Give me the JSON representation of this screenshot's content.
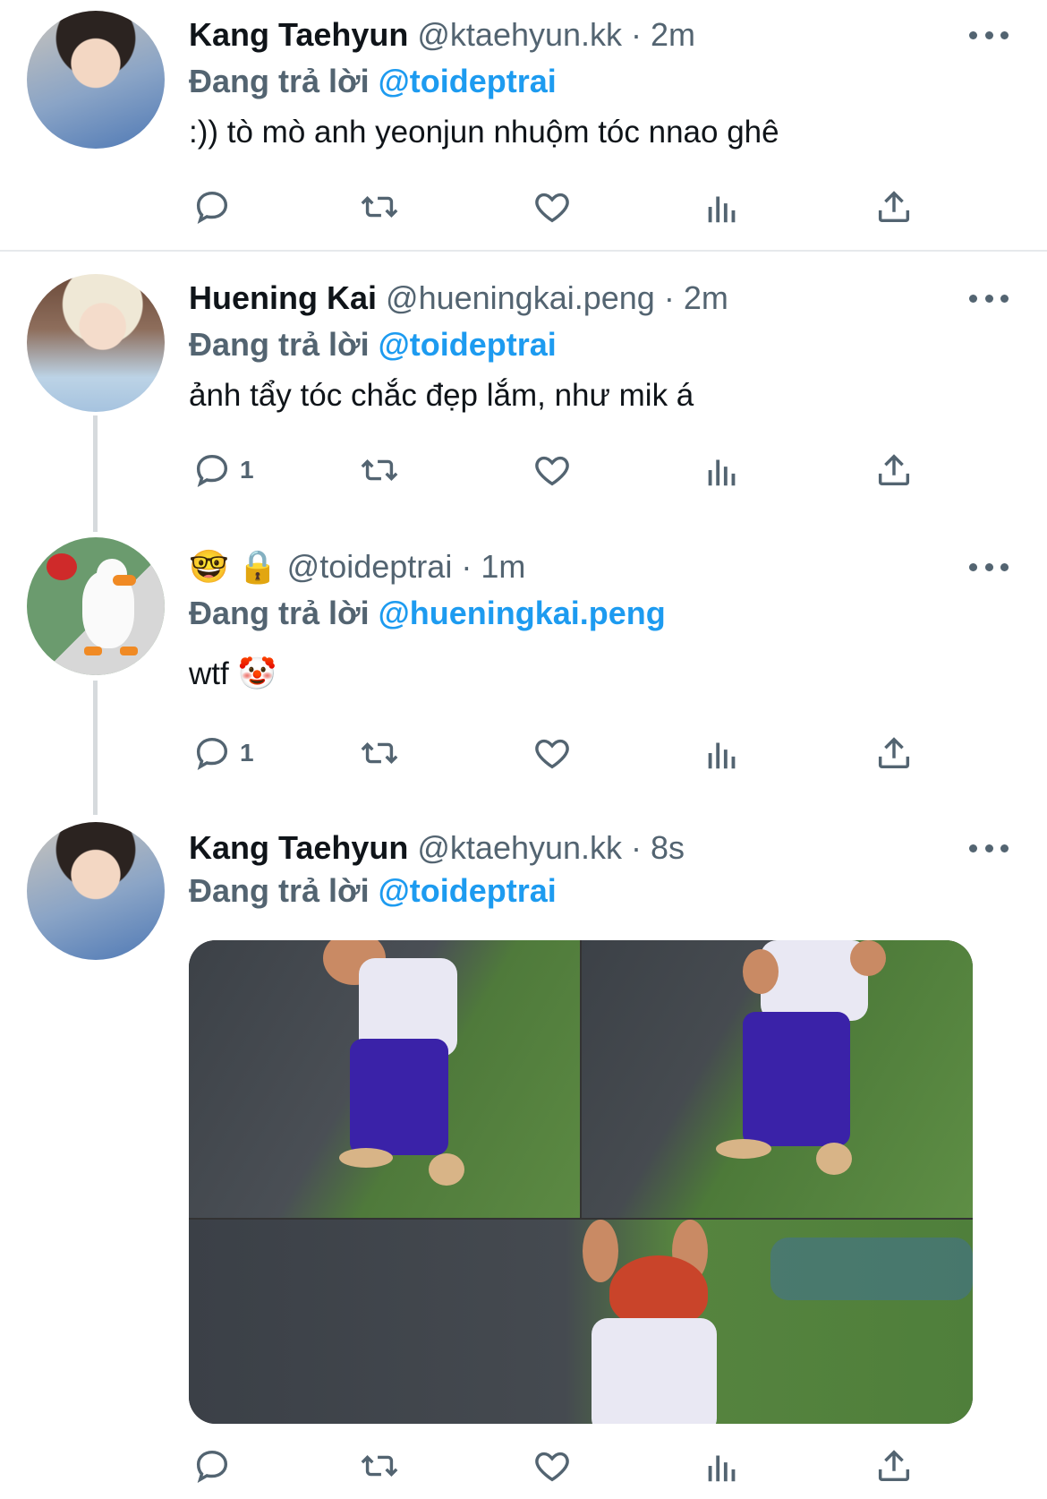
{
  "tweets": [
    {
      "name": "Kang Taehyun",
      "handle": "@ktaehyun.kk",
      "time": "· 2m",
      "reply_prefix": "Đang trả lời",
      "reply_to": "@toideptrai",
      "text": ":)) tò mò anh yeonjun nhuộm tóc nnao ghê",
      "reply_count": ""
    },
    {
      "name": "Huening Kai",
      "handle": "@hueningkai.peng",
      "time": "· 2m",
      "reply_prefix": "Đang trả lời",
      "reply_to": "@toideptrai",
      "text": "ảnh tẩy tóc chắc đẹp lắm, như mik á",
      "reply_count": "1"
    },
    {
      "name": "🤓 🔒",
      "handle": "@toideptrai",
      "time": "· 1m",
      "reply_prefix": "Đang trả lời",
      "reply_to": "@hueningkai.peng",
      "text": "wtf 🤡",
      "reply_count": "1"
    },
    {
      "name": "Kang Taehyun",
      "handle": "@ktaehyun.kk",
      "time": "· 8s",
      "reply_prefix": "Đang trả lời",
      "reply_to": "@toideptrai",
      "text": "",
      "reply_count": ""
    }
  ],
  "icons": [
    "reply-icon",
    "retweet-icon",
    "like-icon",
    "views-icon",
    "share-icon",
    "more-icon"
  ],
  "colors": {
    "mention": "#1d9bf0",
    "muted": "#536471",
    "text": "#0f1419",
    "divider": "#e6e9ec"
  }
}
